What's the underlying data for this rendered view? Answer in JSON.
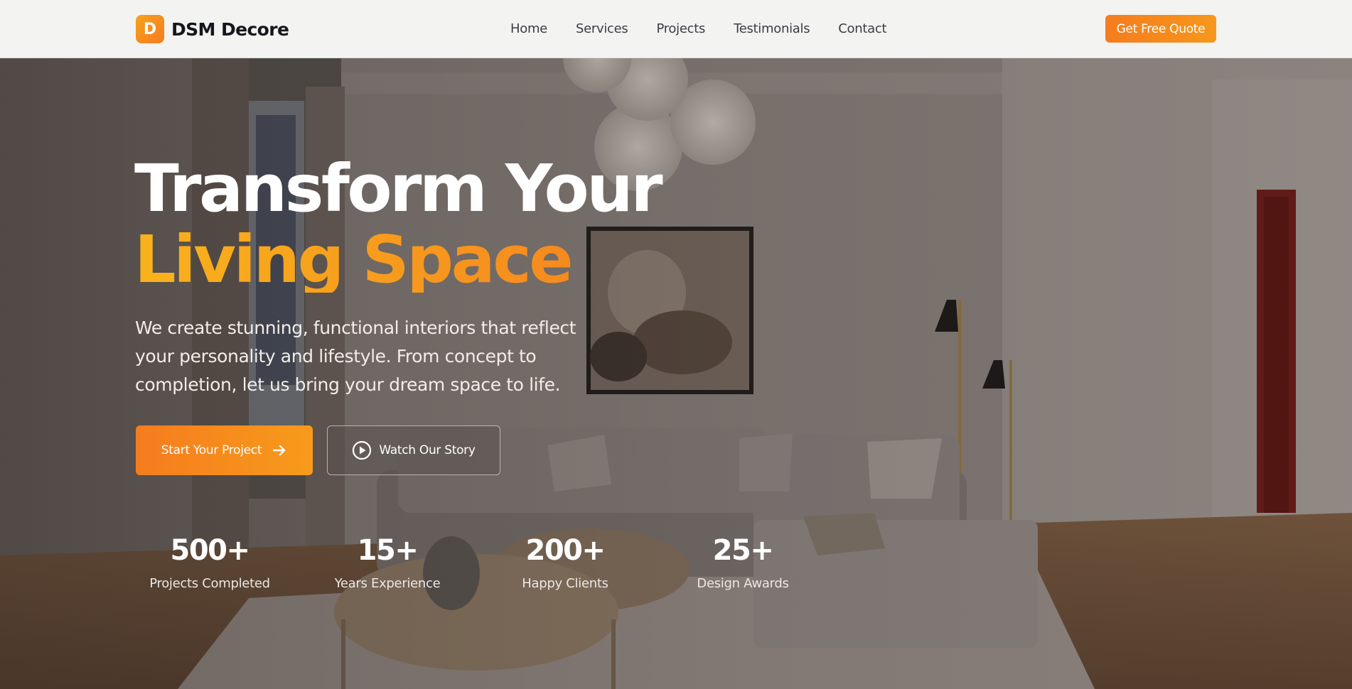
{
  "brand": {
    "mark": "D",
    "name": "DSM Decore"
  },
  "nav": {
    "items": [
      "Home",
      "Services",
      "Projects",
      "Testimonials",
      "Contact"
    ],
    "cta": "Get Free Quote"
  },
  "hero": {
    "title_line1": "Transform Your",
    "title_line2": "Living Space",
    "description": "We create stunning, functional interiors that reflect your personality and lifestyle. From concept to completion, let us bring your dream space to life.",
    "primary_button": "Start Your Project",
    "secondary_button": "Watch Our Story"
  },
  "stats": [
    {
      "value": "500+",
      "label": "Projects Completed"
    },
    {
      "value": "15+",
      "label": "Years Experience"
    },
    {
      "value": "200+",
      "label": "Happy Clients"
    },
    {
      "value": "25+",
      "label": "Design Awards"
    }
  ],
  "colors": {
    "accent": "#f57c1e",
    "accent_light": "#f7a11c",
    "nav_bg": "#f3f3f2"
  },
  "icons": {
    "primary_button_icon": "arrow-right-icon",
    "secondary_button_icon": "play-circle-icon"
  }
}
